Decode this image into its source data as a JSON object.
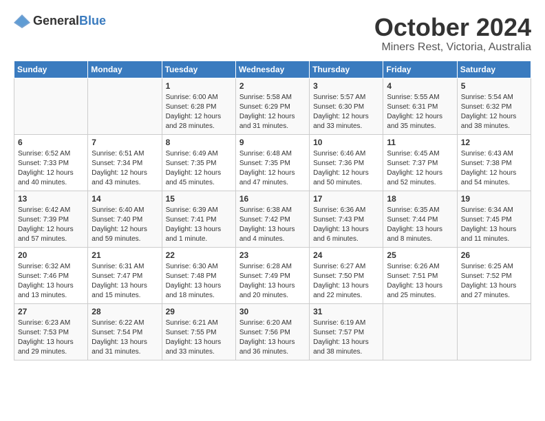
{
  "header": {
    "logo_general": "General",
    "logo_blue": "Blue",
    "month": "October 2024",
    "location": "Miners Rest, Victoria, Australia"
  },
  "weekdays": [
    "Sunday",
    "Monday",
    "Tuesday",
    "Wednesday",
    "Thursday",
    "Friday",
    "Saturday"
  ],
  "weeks": [
    [
      {
        "day": "",
        "sunrise": "",
        "sunset": "",
        "daylight": ""
      },
      {
        "day": "",
        "sunrise": "",
        "sunset": "",
        "daylight": ""
      },
      {
        "day": "1",
        "sunrise": "Sunrise: 6:00 AM",
        "sunset": "Sunset: 6:28 PM",
        "daylight": "Daylight: 12 hours and 28 minutes."
      },
      {
        "day": "2",
        "sunrise": "Sunrise: 5:58 AM",
        "sunset": "Sunset: 6:29 PM",
        "daylight": "Daylight: 12 hours and 31 minutes."
      },
      {
        "day": "3",
        "sunrise": "Sunrise: 5:57 AM",
        "sunset": "Sunset: 6:30 PM",
        "daylight": "Daylight: 12 hours and 33 minutes."
      },
      {
        "day": "4",
        "sunrise": "Sunrise: 5:55 AM",
        "sunset": "Sunset: 6:31 PM",
        "daylight": "Daylight: 12 hours and 35 minutes."
      },
      {
        "day": "5",
        "sunrise": "Sunrise: 5:54 AM",
        "sunset": "Sunset: 6:32 PM",
        "daylight": "Daylight: 12 hours and 38 minutes."
      }
    ],
    [
      {
        "day": "6",
        "sunrise": "Sunrise: 6:52 AM",
        "sunset": "Sunset: 7:33 PM",
        "daylight": "Daylight: 12 hours and 40 minutes."
      },
      {
        "day": "7",
        "sunrise": "Sunrise: 6:51 AM",
        "sunset": "Sunset: 7:34 PM",
        "daylight": "Daylight: 12 hours and 43 minutes."
      },
      {
        "day": "8",
        "sunrise": "Sunrise: 6:49 AM",
        "sunset": "Sunset: 7:35 PM",
        "daylight": "Daylight: 12 hours and 45 minutes."
      },
      {
        "day": "9",
        "sunrise": "Sunrise: 6:48 AM",
        "sunset": "Sunset: 7:35 PM",
        "daylight": "Daylight: 12 hours and 47 minutes."
      },
      {
        "day": "10",
        "sunrise": "Sunrise: 6:46 AM",
        "sunset": "Sunset: 7:36 PM",
        "daylight": "Daylight: 12 hours and 50 minutes."
      },
      {
        "day": "11",
        "sunrise": "Sunrise: 6:45 AM",
        "sunset": "Sunset: 7:37 PM",
        "daylight": "Daylight: 12 hours and 52 minutes."
      },
      {
        "day": "12",
        "sunrise": "Sunrise: 6:43 AM",
        "sunset": "Sunset: 7:38 PM",
        "daylight": "Daylight: 12 hours and 54 minutes."
      }
    ],
    [
      {
        "day": "13",
        "sunrise": "Sunrise: 6:42 AM",
        "sunset": "Sunset: 7:39 PM",
        "daylight": "Daylight: 12 hours and 57 minutes."
      },
      {
        "day": "14",
        "sunrise": "Sunrise: 6:40 AM",
        "sunset": "Sunset: 7:40 PM",
        "daylight": "Daylight: 12 hours and 59 minutes."
      },
      {
        "day": "15",
        "sunrise": "Sunrise: 6:39 AM",
        "sunset": "Sunset: 7:41 PM",
        "daylight": "Daylight: 13 hours and 1 minute."
      },
      {
        "day": "16",
        "sunrise": "Sunrise: 6:38 AM",
        "sunset": "Sunset: 7:42 PM",
        "daylight": "Daylight: 13 hours and 4 minutes."
      },
      {
        "day": "17",
        "sunrise": "Sunrise: 6:36 AM",
        "sunset": "Sunset: 7:43 PM",
        "daylight": "Daylight: 13 hours and 6 minutes."
      },
      {
        "day": "18",
        "sunrise": "Sunrise: 6:35 AM",
        "sunset": "Sunset: 7:44 PM",
        "daylight": "Daylight: 13 hours and 8 minutes."
      },
      {
        "day": "19",
        "sunrise": "Sunrise: 6:34 AM",
        "sunset": "Sunset: 7:45 PM",
        "daylight": "Daylight: 13 hours and 11 minutes."
      }
    ],
    [
      {
        "day": "20",
        "sunrise": "Sunrise: 6:32 AM",
        "sunset": "Sunset: 7:46 PM",
        "daylight": "Daylight: 13 hours and 13 minutes."
      },
      {
        "day": "21",
        "sunrise": "Sunrise: 6:31 AM",
        "sunset": "Sunset: 7:47 PM",
        "daylight": "Daylight: 13 hours and 15 minutes."
      },
      {
        "day": "22",
        "sunrise": "Sunrise: 6:30 AM",
        "sunset": "Sunset: 7:48 PM",
        "daylight": "Daylight: 13 hours and 18 minutes."
      },
      {
        "day": "23",
        "sunrise": "Sunrise: 6:28 AM",
        "sunset": "Sunset: 7:49 PM",
        "daylight": "Daylight: 13 hours and 20 minutes."
      },
      {
        "day": "24",
        "sunrise": "Sunrise: 6:27 AM",
        "sunset": "Sunset: 7:50 PM",
        "daylight": "Daylight: 13 hours and 22 minutes."
      },
      {
        "day": "25",
        "sunrise": "Sunrise: 6:26 AM",
        "sunset": "Sunset: 7:51 PM",
        "daylight": "Daylight: 13 hours and 25 minutes."
      },
      {
        "day": "26",
        "sunrise": "Sunrise: 6:25 AM",
        "sunset": "Sunset: 7:52 PM",
        "daylight": "Daylight: 13 hours and 27 minutes."
      }
    ],
    [
      {
        "day": "27",
        "sunrise": "Sunrise: 6:23 AM",
        "sunset": "Sunset: 7:53 PM",
        "daylight": "Daylight: 13 hours and 29 minutes."
      },
      {
        "day": "28",
        "sunrise": "Sunrise: 6:22 AM",
        "sunset": "Sunset: 7:54 PM",
        "daylight": "Daylight: 13 hours and 31 minutes."
      },
      {
        "day": "29",
        "sunrise": "Sunrise: 6:21 AM",
        "sunset": "Sunset: 7:55 PM",
        "daylight": "Daylight: 13 hours and 33 minutes."
      },
      {
        "day": "30",
        "sunrise": "Sunrise: 6:20 AM",
        "sunset": "Sunset: 7:56 PM",
        "daylight": "Daylight: 13 hours and 36 minutes."
      },
      {
        "day": "31",
        "sunrise": "Sunrise: 6:19 AM",
        "sunset": "Sunset: 7:57 PM",
        "daylight": "Daylight: 13 hours and 38 minutes."
      },
      {
        "day": "",
        "sunrise": "",
        "sunset": "",
        "daylight": ""
      },
      {
        "day": "",
        "sunrise": "",
        "sunset": "",
        "daylight": ""
      }
    ]
  ]
}
